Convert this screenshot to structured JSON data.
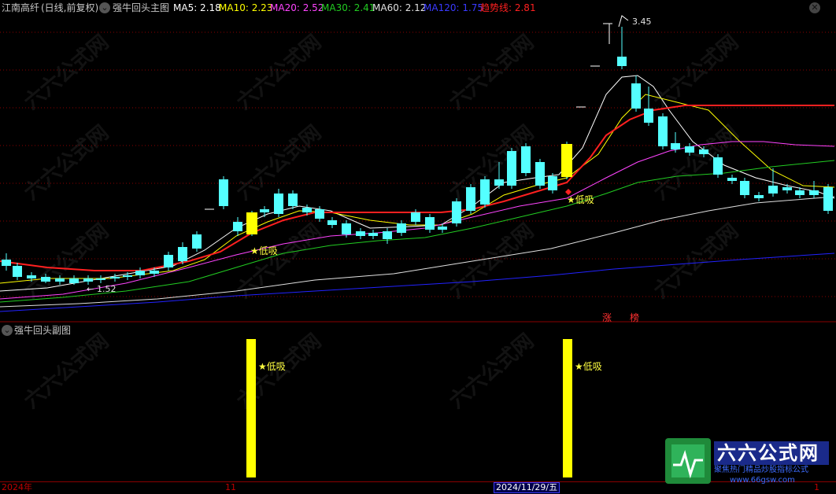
{
  "main_chart": {
    "stock_name": "江南高纤",
    "period": "(日线,前复权)",
    "indicator_name": "强牛回头主图",
    "ma_items": [
      {
        "label": "MA5: 2.18",
        "color": "#ffffff"
      },
      {
        "label": "MA10: 2.23",
        "color": "#ffff00"
      },
      {
        "label": "MA20: 2.52",
        "color": "#ff44ff"
      },
      {
        "label": "MA30: 2.41",
        "color": "#22cc22"
      },
      {
        "label": "MA60: 2.12",
        "color": "#e0e0e0"
      },
      {
        "label": "MA120: 1.75",
        "color": "#2222ff"
      },
      {
        "label": "趋势线: 2.81",
        "color": "#ff2020"
      }
    ],
    "high_label": "3.45",
    "low_label": "1.52",
    "signal_labels": [
      "★低吸",
      "★低吸"
    ],
    "bottom_tags": [
      "涨",
      "榜"
    ]
  },
  "sub_chart": {
    "title": "强牛回头副图",
    "signal_labels": [
      "★低吸",
      "★低吸"
    ]
  },
  "time_axis": {
    "year_label": "2024年",
    "month_label": "11",
    "cursor_date": "2024/11/29/五",
    "right_label": "1"
  },
  "watermark": {
    "brand": "六六公式网",
    "slogan": "聚焦热门精品炒股指标公式",
    "url": "www.66gsw.com"
  },
  "colors": {
    "up_candle": "#ff3030",
    "down_candle": "#54ffff",
    "trend_line": "#ff2020",
    "signal_bar": "#ffff00",
    "grid": "#8a0000"
  }
}
